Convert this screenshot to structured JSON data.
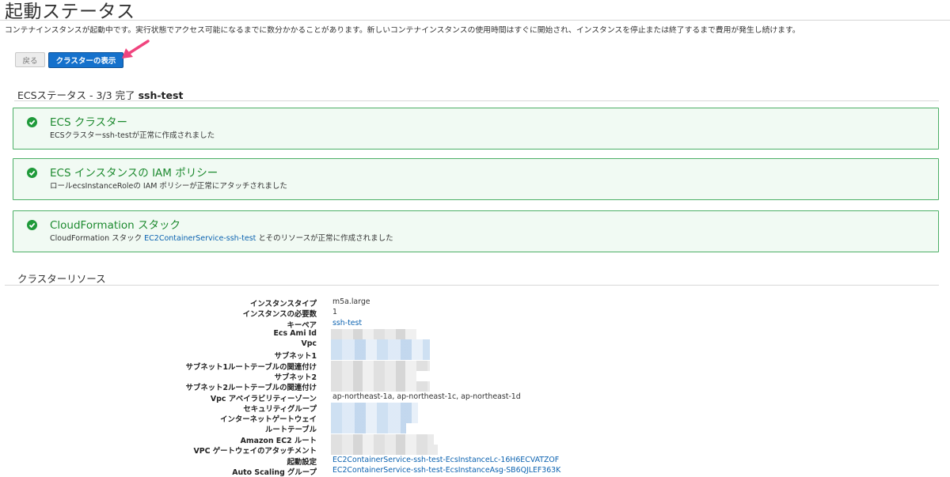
{
  "page": {
    "title": "起動ステータス",
    "intro": "コンテナインスタンスが起動中です。実行状態でアクセス可能になるまでに数分かかることがあります。新しいコンテナインスタンスの使用時間はすぐに開始され、インスタンスを停止または終了するまで費用が発生し続けます。"
  },
  "actions": {
    "back_label": "戻る",
    "view_cluster_label": "クラスターの表示"
  },
  "ecs_status": {
    "heading": "ECSステータス - 3/3 完了",
    "cluster_name": "ssh-test",
    "cards": [
      {
        "title": "ECS クラスター",
        "desc": "ECSクラスターssh-testが正常に作成されました"
      },
      {
        "title": "ECS インスタンスの IAM ポリシー",
        "desc": "ロールecsInstanceRoleの IAM ポリシーが正常にアタッチされました"
      },
      {
        "title": "CloudFormation スタック",
        "desc_prefix": "CloudFormation スタック ",
        "desc_link": "EC2ContainerService-ssh-test",
        "desc_suffix": " とそのリソースが正常に作成されました"
      }
    ]
  },
  "resources": {
    "heading": "クラスターリソース",
    "rows": [
      {
        "label": "インスタンスタイプ",
        "value": "m5a.large"
      },
      {
        "label": "インスタンスの必要数",
        "value": "1"
      },
      {
        "label": "キーペア",
        "value": "ssh-test"
      },
      {
        "label": "Ecs Ami Id"
      },
      {
        "label": "Vpc"
      },
      {
        "label": "サブネット1"
      },
      {
        "label": "サブネット1ルートテーブルの関連付け"
      },
      {
        "label": "サブネット2"
      },
      {
        "label": "サブネット2ルートテーブルの関連付け"
      },
      {
        "label": "Vpc アベイラビリティーゾーン",
        "value": "ap-northeast-1a, ap-northeast-1c, ap-northeast-1d"
      },
      {
        "label": "セキュリティグループ"
      },
      {
        "label": "インターネットゲートウェイ"
      },
      {
        "label": "ルートテーブル"
      },
      {
        "label": "Amazon EC2 ルート"
      },
      {
        "label": "VPC ゲートウェイのアタッチメント"
      },
      {
        "label": "起動設定",
        "value": "EC2ContainerService-ssh-test-EcsInstanceLc-16H6ECVATZOF"
      },
      {
        "label": "Auto Scaling グループ",
        "value": "EC2ContainerService-ssh-test-EcsInstanceAsg-SB6QJLEF363K"
      }
    ]
  },
  "colors": {
    "primary_button": "#1571cc",
    "success_green": "#1d8a2f",
    "link_blue": "#0b62b0",
    "annotation_arrow": "#f0447e"
  }
}
